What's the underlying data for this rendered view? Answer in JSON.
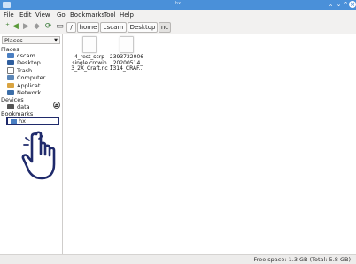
{
  "window": {
    "title": "hx"
  },
  "menubar": [
    "File",
    "Edit",
    "View",
    "Go",
    "Bookmarks",
    "Tool",
    "Help"
  ],
  "breadcrumbs": {
    "root": "/",
    "items": [
      "home",
      "cscam",
      "Desktop",
      "nc"
    ]
  },
  "sidebar": {
    "combo": "Places",
    "places_heading": "Places",
    "places": [
      "cscam",
      "Desktop",
      "Trash",
      "Computer",
      "Applicat...",
      "Network"
    ],
    "devices_heading": "Devices",
    "devices": [
      "data"
    ],
    "bookmarks_heading": "Bookmarks",
    "bookmarks": [
      "hx"
    ]
  },
  "files": [
    {
      "line1": "4_rest_scrp",
      "line2": "single crowin",
      "line3": "3_2X_Craft.nc"
    },
    {
      "line1": "2393722006",
      "line2": "_20200514_",
      "line3": "1314_CRAF..."
    }
  ],
  "status": "Free space: 1.3 GB (Total: 5.8 GB)",
  "colors": {
    "titlebar": "#4a90d9",
    "hand_outline": "#1f2a6b",
    "selection": "#cfe3f8"
  }
}
